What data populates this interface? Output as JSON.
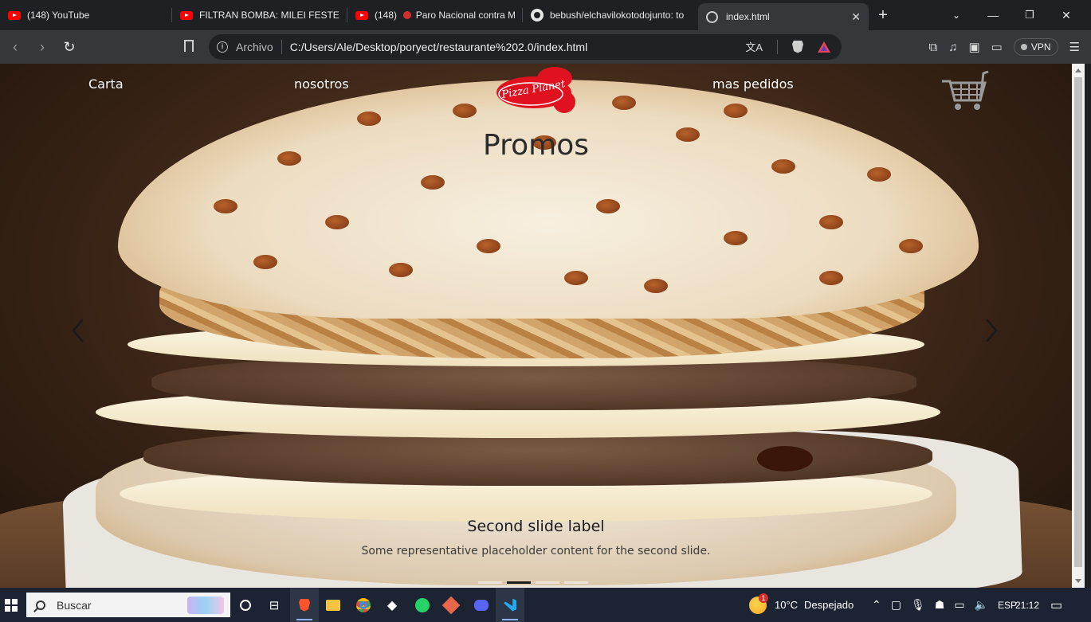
{
  "browser": {
    "tabs": [
      {
        "label": "(148) YouTube",
        "icon": "youtube-icon"
      },
      {
        "label": "FILTRAN BOMBA: MILEI FESTEJA",
        "icon": "youtube-icon"
      },
      {
        "label": "(148)",
        "label2": "Paro Nacional contra M",
        "icon": "youtube-icon"
      },
      {
        "label": "bebush/elchavilokotodojunto: to",
        "icon": "github-icon"
      },
      {
        "label": "index.html",
        "icon": "globe-icon"
      }
    ],
    "address": {
      "security_label": "Archivo",
      "url": "C:/Users/Ale/Desktop/poryect/restaurante%202.0/index.html"
    },
    "vpn_label": "VPN"
  },
  "page": {
    "nav": {
      "carta": "Carta",
      "nosotros": "nosotros",
      "mas_pedidos": "mas pedidos",
      "logo_text": "Pizza Planet"
    },
    "heading": "Promos",
    "carousel": {
      "slide_label": "Second slide label",
      "slide_text": "Some representative placeholder content for the second slide.",
      "indicator_count": 4,
      "active_index": 1
    }
  },
  "taskbar": {
    "search_placeholder": "Buscar",
    "weather": {
      "temp": "10°C",
      "desc": "Despejado",
      "badge": "1"
    },
    "lang": "ESP",
    "time": "21:12"
  },
  "colors": {
    "logo_red": "#e0121f",
    "chrome_bg": "#1f2023",
    "taskbar_bg": "#1c2433"
  }
}
